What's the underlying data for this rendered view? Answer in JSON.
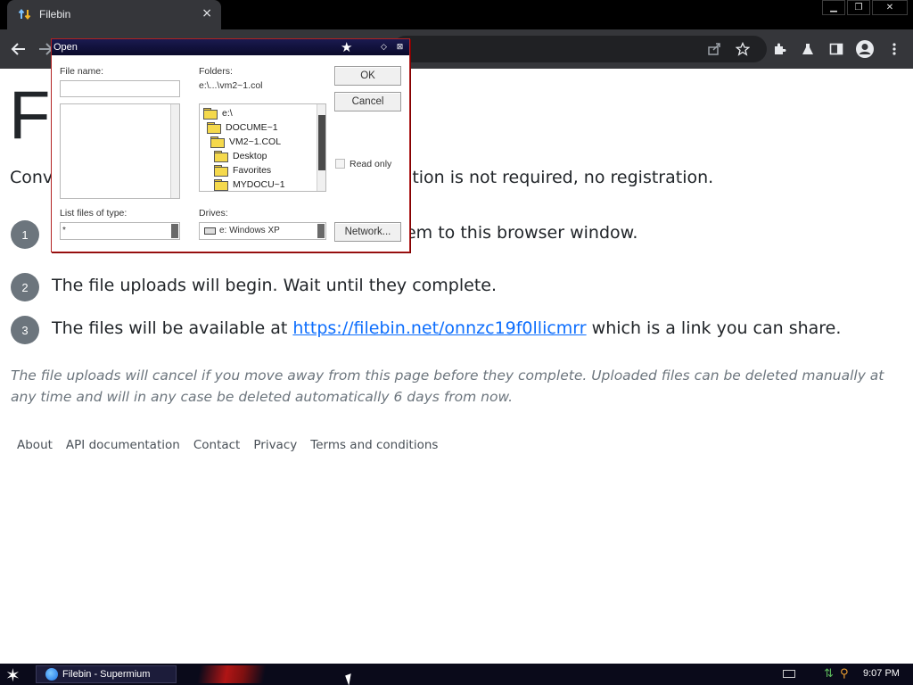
{
  "browser": {
    "tab_title": "Filebin",
    "tab_close": "×",
    "win_min": "▁",
    "win_max": "❐",
    "win_close": "✕"
  },
  "page": {
    "title": "Filebin",
    "intro": "Convenient file sharing in the browser. Registration is not required, no registration.",
    "steps": [
      {
        "num": "1",
        "text": "Select files to upload, or drag and drop them to this browser window."
      },
      {
        "num": "2",
        "text": "The file uploads will begin. Wait until they complete."
      },
      {
        "num": "3",
        "text_before": "The files will be available at ",
        "link": "https://filebin.net/onnzc19f0llicmrr",
        "text_after": " which is a link you can share."
      }
    ],
    "notice": "The file uploads will cancel if you move away from this page before they complete. Uploaded files can be deleted manually at any time and will in any case be deleted automatically 6 days from now.",
    "footer": [
      "About",
      "API documentation",
      "Contact",
      "Privacy",
      "Terms and conditions"
    ]
  },
  "dialog": {
    "title": "Open",
    "file_name_label": "File name:",
    "file_name_value": "",
    "folders_label": "Folders:",
    "current_folder": "e:\\...\\vm2~1.col",
    "folders": [
      "e:\\",
      "DOCUME~1",
      "VM2~1.COL",
      "Desktop",
      "Favorites",
      "MYDOCU~1"
    ],
    "file_types_label": "List files of type:",
    "file_type_value": "*",
    "drives_label": "Drives:",
    "drive_value": "e: Windows XP",
    "ok_label": "OK",
    "cancel_label": "Cancel",
    "read_only_label": "Read only",
    "network_label": "Network..."
  },
  "taskbar": {
    "task_label": "Filebin - Supermium",
    "clock": "9:07 PM"
  }
}
